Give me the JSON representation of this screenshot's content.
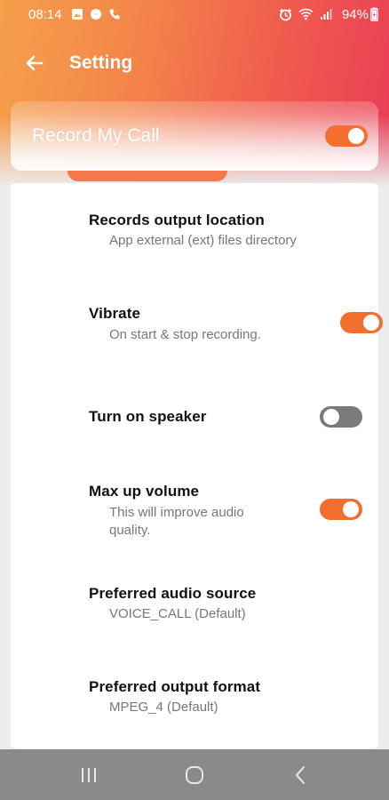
{
  "status_bar": {
    "time": "08:14",
    "battery": "94%",
    "icons_left": [
      "gallery-icon",
      "messenger-icon",
      "call-icon"
    ],
    "icons_right": [
      "alarm-icon",
      "wifi-icon",
      "signal-icon",
      "battery-icon"
    ]
  },
  "appbar": {
    "title": "Setting",
    "back_icon": "arrow-left-icon"
  },
  "record_card": {
    "title": "Record My Call",
    "enabled": true
  },
  "settings": [
    {
      "title": "Records output location",
      "subtitle": "App external (ext) files directory"
    },
    {
      "title": "Vibrate",
      "subtitle": "On start & stop recording.",
      "toggle": true
    },
    {
      "title": "Turn on speaker",
      "subtitle": "",
      "toggle": false
    },
    {
      "title": "Max up volume",
      "subtitle": "This will improve audio quality.",
      "toggle": true
    },
    {
      "title": "Preferred audio source",
      "subtitle": "VOICE_CALL (Default)"
    },
    {
      "title": "Preferred output format",
      "subtitle": "MPEG_4 (Default)"
    }
  ],
  "navbar": {
    "buttons": [
      "recent-apps-icon",
      "home-icon",
      "back-icon"
    ]
  },
  "colors": {
    "accent": "#f36f2f",
    "gradient_start": "#f5a04a",
    "gradient_end": "#ea3d57",
    "toggle_off": "#7a7a7a",
    "navbar": "#8a8a8a"
  }
}
